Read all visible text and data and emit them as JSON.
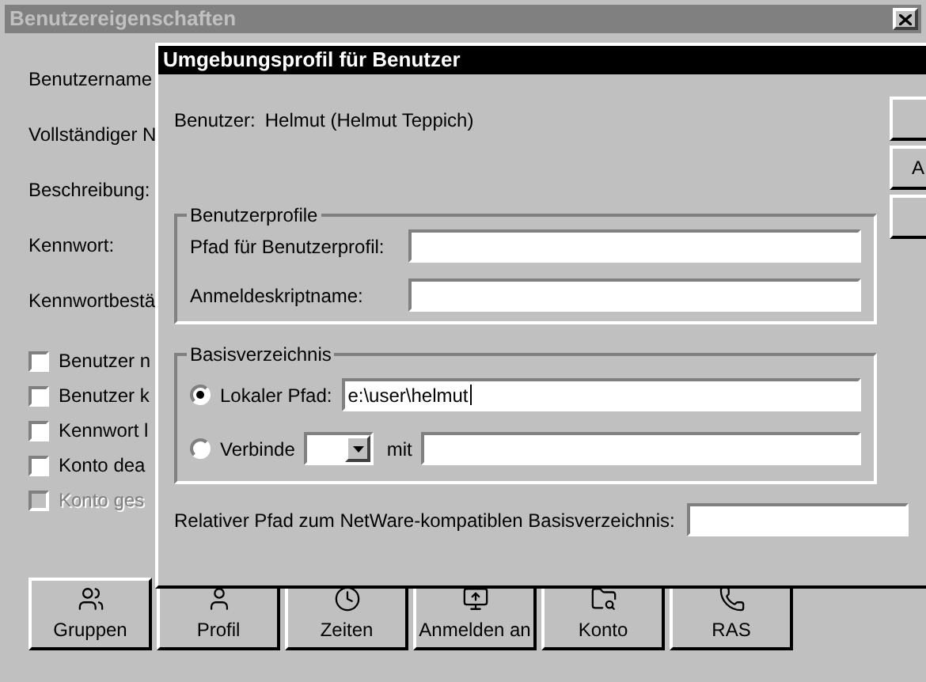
{
  "back_window": {
    "title": "Benutzereigenschaften",
    "fields": [
      {
        "label": "Benutzername"
      },
      {
        "label": "Vollständiger N"
      },
      {
        "label": "Beschreibung:"
      },
      {
        "label": "Kennwort:"
      },
      {
        "label": "Kennwortbestä"
      }
    ],
    "checkboxes": [
      {
        "label": "Benutzer n",
        "checked": false,
        "disabled": false
      },
      {
        "label": "Benutzer k",
        "checked": false,
        "disabled": false
      },
      {
        "label": "Kennwort l",
        "checked": false,
        "disabled": false
      },
      {
        "label": "Konto dea",
        "checked": false,
        "disabled": false
      },
      {
        "label": "Konto ges",
        "checked": false,
        "disabled": true
      }
    ],
    "buttons": [
      {
        "label": "Gruppen",
        "kind": "groups"
      },
      {
        "label": "Profil",
        "kind": "profile"
      },
      {
        "label": "Zeiten",
        "kind": "clock"
      },
      {
        "label": "Anmelden an",
        "kind": "logon"
      },
      {
        "label": "Konto",
        "kind": "account"
      },
      {
        "label": "RAS",
        "kind": "ras"
      }
    ]
  },
  "dialog": {
    "title": "Umgebungsprofil für Benutzer",
    "user_label": "Benutzer:",
    "user_value": "Helmut (Helmut Teppich)",
    "side_buttons": [
      {
        "kind": "button"
      },
      {
        "kind": "button",
        "label": "A"
      },
      {
        "kind": "button"
      }
    ],
    "profiles": {
      "title": "Benutzerprofile",
      "fields": [
        {
          "label": "Pfad für Benutzerprofil:"
        },
        {
          "label": "Anmeldeskriptname:"
        }
      ]
    },
    "home_dir": {
      "title": "Basisverzeichnis",
      "options": [
        {
          "kind": "path",
          "label": "Lokaler Pfad:",
          "selected": true,
          "value": "e:\\user\\helmut"
        },
        {
          "kind": "connect",
          "label": "Verbinde",
          "selected": false,
          "connector": "mit"
        }
      ]
    },
    "netware": {
      "label": "Relativer Pfad zum NetWare-kompatiblen Basisverzeichnis:"
    }
  }
}
